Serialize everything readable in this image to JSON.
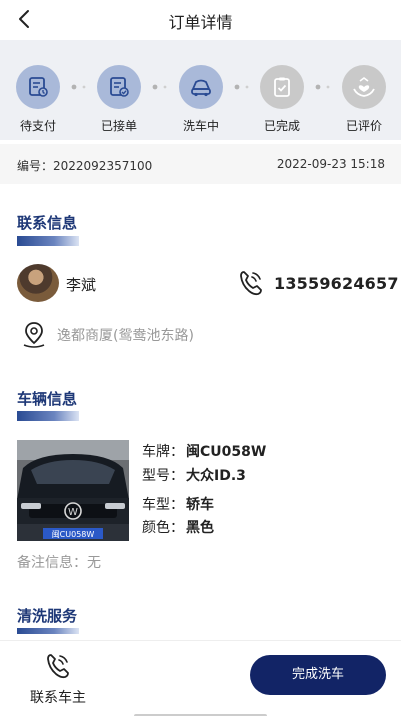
{
  "header": {
    "title": "订单详情",
    "back_icon": "chevron-left-icon"
  },
  "steps": [
    {
      "label": "待支付",
      "icon": "bill-icon",
      "state": "active"
    },
    {
      "label": "已接单",
      "icon": "bill-check-icon",
      "state": "active"
    },
    {
      "label": "洗车中",
      "icon": "car-wash-icon",
      "state": "active"
    },
    {
      "label": "已完成",
      "icon": "clipboard-check-icon",
      "state": "inactive"
    },
    {
      "label": "已评价",
      "icon": "hands-heart-icon",
      "state": "inactive"
    }
  ],
  "order": {
    "number_label": "编号：2022092357100",
    "time": "2022-09-23 15:18"
  },
  "contact": {
    "section_title": "联系信息",
    "name": "李斌",
    "phone": "13559624657",
    "address": "逸都商厦(鸳鸯池东路)"
  },
  "vehicle": {
    "section_title": "车辆信息",
    "plate_label": "车牌：",
    "plate": "闽CU058W",
    "model_label": "型号：",
    "model": "大众ID.3",
    "type_label": "车型：",
    "type": "轿车",
    "color_label": "颜色：",
    "color": "黑色",
    "photo_plate_text": "闽CU058W",
    "remark": "备注信息：无"
  },
  "service": {
    "section_title": "清洗服务"
  },
  "footer": {
    "contact_owner_label": "联系车主",
    "finish_button_label": "完成洗车"
  },
  "colors": {
    "primary": "#122466",
    "accent_title": "#1e3877",
    "step_active": "#a9b9d9",
    "step_inactive": "#c9c9c9"
  }
}
